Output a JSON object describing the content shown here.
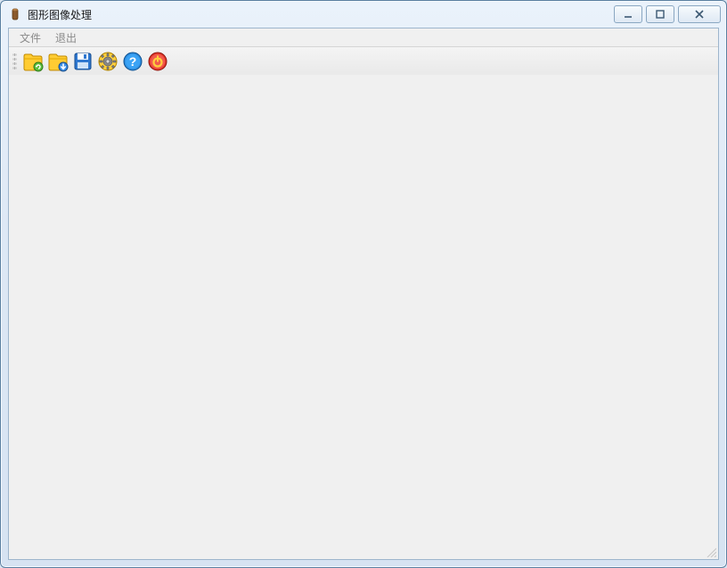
{
  "window": {
    "title": "图形图像处理"
  },
  "menu": {
    "items": [
      {
        "label": "文件"
      },
      {
        "label": "退出"
      }
    ]
  },
  "toolbar": {
    "buttons": [
      {
        "name": "open-folder-refresh",
        "icon": "folder-refresh-icon"
      },
      {
        "name": "open-folder-save",
        "icon": "folder-save-icon"
      },
      {
        "name": "save",
        "icon": "floppy-icon"
      },
      {
        "name": "settings",
        "icon": "gear-icon"
      },
      {
        "name": "help",
        "icon": "help-icon"
      },
      {
        "name": "power",
        "icon": "power-icon"
      }
    ]
  }
}
